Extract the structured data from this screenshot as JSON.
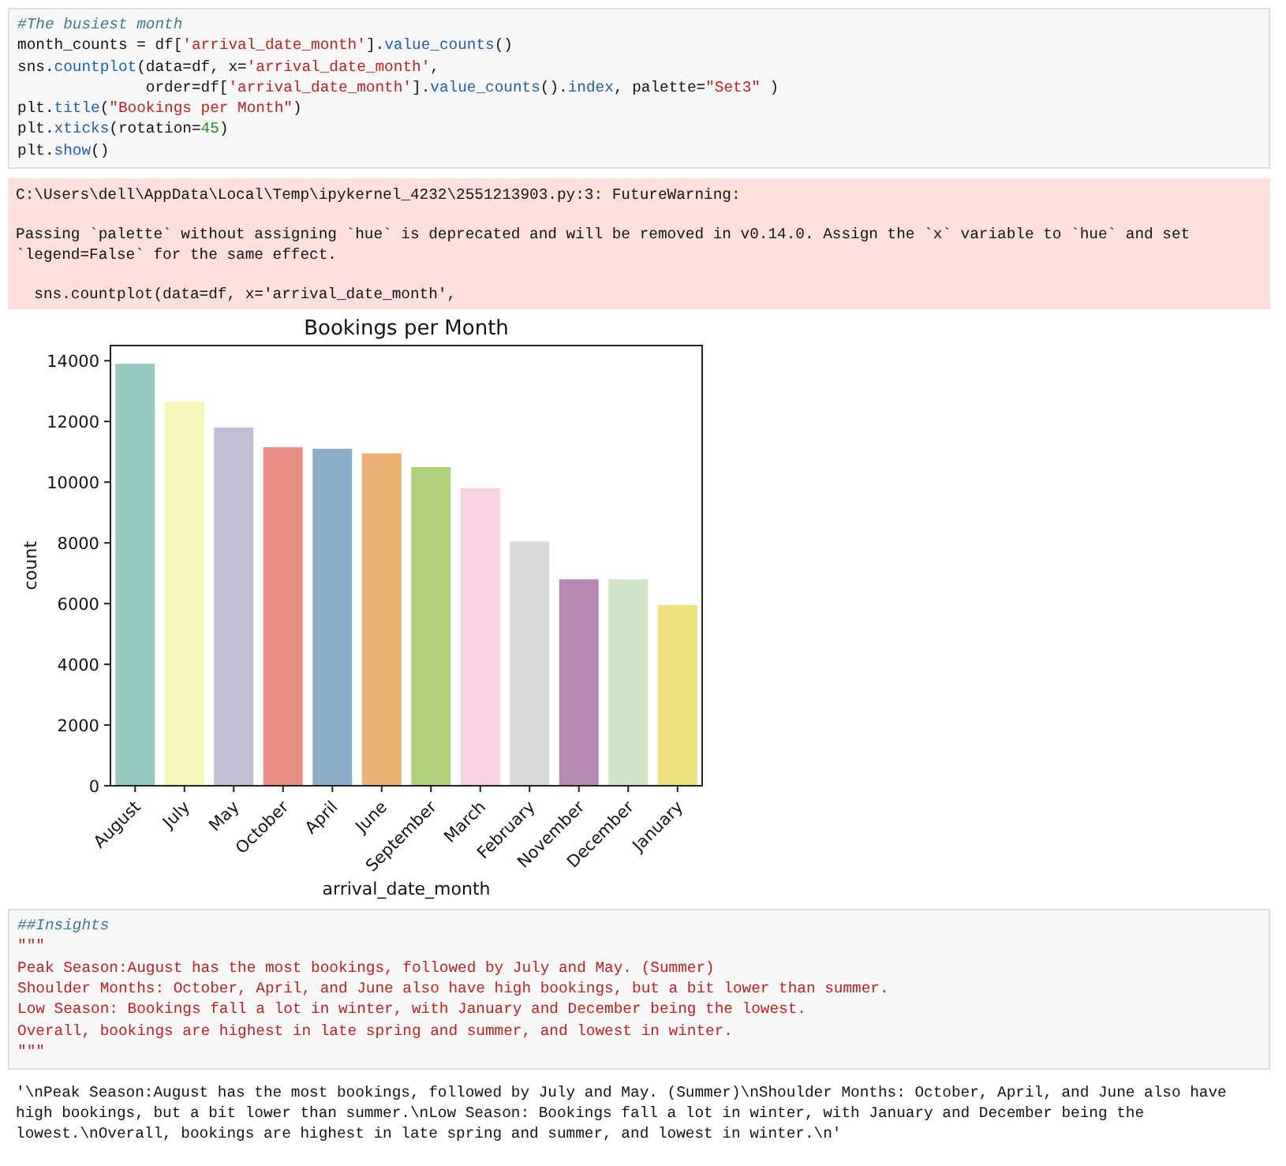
{
  "cells": [
    {
      "kind": "code",
      "lines": [
        [
          {
            "kind": "comment",
            "text": "#The busiest month"
          }
        ],
        [
          {
            "kind": "plain",
            "text": "month_counts = df["
          },
          {
            "kind": "string",
            "text": "'arrival_date_month'"
          },
          {
            "kind": "plain",
            "text": "]."
          },
          {
            "kind": "func",
            "text": "value_counts"
          },
          {
            "kind": "plain",
            "text": "()"
          }
        ],
        [
          {
            "kind": "plain",
            "text": "sns."
          },
          {
            "kind": "func",
            "text": "countplot"
          },
          {
            "kind": "plain",
            "text": "(data=df, x="
          },
          {
            "kind": "string",
            "text": "'arrival_date_month'"
          },
          {
            "kind": "plain",
            "text": ","
          }
        ],
        [
          {
            "kind": "plain",
            "text": "              order=df["
          },
          {
            "kind": "string",
            "text": "'arrival_date_month'"
          },
          {
            "kind": "plain",
            "text": "]."
          },
          {
            "kind": "func",
            "text": "value_counts"
          },
          {
            "kind": "plain",
            "text": "()."
          },
          {
            "kind": "func",
            "text": "index"
          },
          {
            "kind": "plain",
            "text": ", palette="
          },
          {
            "kind": "string",
            "text": "\"Set3\""
          },
          {
            "kind": "plain",
            "text": " )"
          }
        ],
        [
          {
            "kind": "plain",
            "text": "plt."
          },
          {
            "kind": "func",
            "text": "title"
          },
          {
            "kind": "plain",
            "text": "("
          },
          {
            "kind": "string",
            "text": "\"Bookings per Month\""
          },
          {
            "kind": "plain",
            "text": ")"
          }
        ],
        [
          {
            "kind": "plain",
            "text": "plt."
          },
          {
            "kind": "func",
            "text": "xticks"
          },
          {
            "kind": "plain",
            "text": "(rotation="
          },
          {
            "kind": "number",
            "text": "45"
          },
          {
            "kind": "plain",
            "text": ")"
          }
        ],
        [
          {
            "kind": "plain",
            "text": "plt."
          },
          {
            "kind": "func",
            "text": "show"
          },
          {
            "kind": "plain",
            "text": "()"
          }
        ]
      ]
    },
    {
      "kind": "warning",
      "paragraphs": [
        "C:\\Users\\dell\\AppData\\Local\\Temp\\ipykernel_4232\\2551213903.py:3: FutureWarning:",
        "Passing `palette` without assigning `hue` is deprecated and will be removed in v0.14.0. Assign the `x` variable to `hue` and set `legend=False` for the same effect.",
        "  sns.countplot(data=df, x='arrival_date_month',"
      ]
    },
    {
      "kind": "chart",
      "chart_data": {
        "type": "bar",
        "title": "Bookings per Month",
        "xlabel": "arrival_date_month",
        "ylabel": "count",
        "categories": [
          "August",
          "July",
          "May",
          "October",
          "April",
          "June",
          "September",
          "March",
          "February",
          "November",
          "December",
          "January"
        ],
        "series": [
          {
            "colors": [
              "#97c9c2",
              "#f6f5b9",
              "#c1bdd6",
              "#ea8e83",
              "#8aaec8",
              "#eab173",
              "#b0d07b",
              "#f6d2e3",
              "#d9d9d9",
              "#b888b5",
              "#d1e6c9",
              "#ede07f"
            ],
            "values": [
              13900,
              12650,
              11800,
              11150,
              11100,
              10950,
              10500,
              9800,
              8050,
              6800,
              6800,
              5950
            ]
          }
        ],
        "ylim": [
          0,
          14500
        ],
        "yticks": [
          0,
          2000,
          4000,
          6000,
          8000,
          10000,
          12000,
          14000
        ]
      }
    },
    {
      "kind": "code",
      "lines": [
        [
          {
            "kind": "comment",
            "text": "##Insights"
          }
        ],
        [
          {
            "kind": "string",
            "text": "\"\"\""
          }
        ],
        [
          {
            "kind": "string",
            "text": "Peak Season:August has the most bookings, followed by July and May. (Summer)"
          }
        ],
        [
          {
            "kind": "string",
            "text": "Shoulder Months: October, April, and June also have high bookings, but a bit lower than summer."
          }
        ],
        [
          {
            "kind": "string",
            "text": "Low Season: Bookings fall a lot in winter, with January and December being the lowest."
          }
        ],
        [
          {
            "kind": "string",
            "text": "Overall, bookings are highest in late spring and summer, and lowest in winter."
          }
        ],
        [
          {
            "kind": "string",
            "text": "\"\"\""
          }
        ]
      ]
    },
    {
      "kind": "output",
      "text": "'\\nPeak Season:August has the most bookings, followed by July and May. (Summer)\\nShoulder Months: October, April, and June also have high bookings, but a bit lower than summer.\\nLow Season: Bookings fall a lot in winter, with January and December being the lowest.\\nOverall, bookings are highest in late spring and summer, and lowest in winter.\\n'"
    }
  ]
}
